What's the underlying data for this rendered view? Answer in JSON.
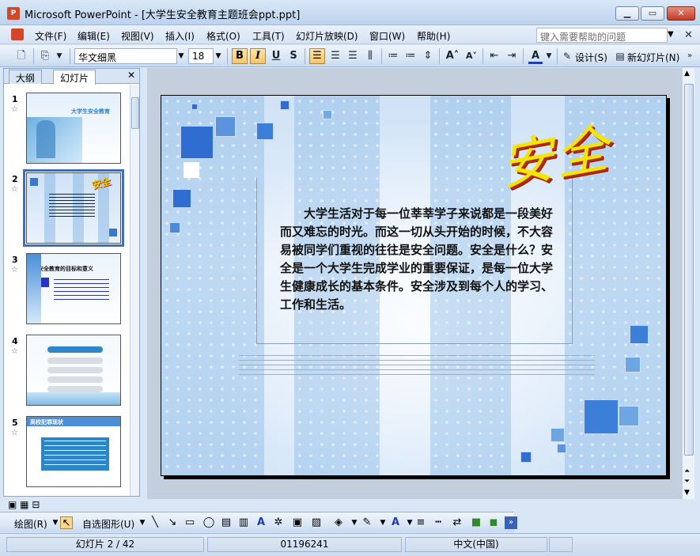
{
  "window": {
    "title": "Microsoft PowerPoint - [大学生安全教育主题班会ppt.ppt]",
    "app_icon_text": "P"
  },
  "menu": {
    "items": [
      "文件(F)",
      "编辑(E)",
      "视图(V)",
      "插入(I)",
      "格式(O)",
      "工具(T)",
      "幻灯片放映(D)",
      "窗口(W)",
      "帮助(H)"
    ],
    "help_placeholder": "键入需要帮助的问题"
  },
  "toolbar": {
    "font_name": "华文细黑",
    "font_size": "18",
    "bold": "B",
    "italic": "I",
    "underline": "U",
    "shadow": "S",
    "design_label": "设计(S)",
    "new_slide_label": "新幻灯片(N)"
  },
  "panel": {
    "tab_outline": "大纲",
    "tab_slides": "幻灯片",
    "thumbnails": [
      {
        "num": "1",
        "title": "大学生安全教育"
      },
      {
        "num": "2",
        "title": ""
      },
      {
        "num": "3",
        "title": "安全教育的目标和意义"
      },
      {
        "num": "4",
        "title": ""
      },
      {
        "num": "5",
        "title": "高校犯罪现状"
      }
    ],
    "selected_index": 2
  },
  "slide": {
    "wordart": "安全",
    "body": "大学生活对于每一位莘莘学子来说都是一段美好而又难忘的时光。而这一切从头开始的时候，不大容易被同学们重视的往往是安全问题。安全是什么？安全是一个大学生完成学业的重要保证，是每一位大学生健康成长的基本条件。安全涉及到每个人的学习、工作和生活。"
  },
  "drawbar": {
    "draw_label": "绘图(R)",
    "autoshape_label": "自选图形(U)"
  },
  "status": {
    "slide_info": "幻灯片 2 / 42",
    "template": "01196241",
    "language": "中文(中国)"
  },
  "colors": {
    "accent": "#3f6fb8",
    "wordart_fill": "#f4e600",
    "wordart_shadow": "#b42a10"
  }
}
